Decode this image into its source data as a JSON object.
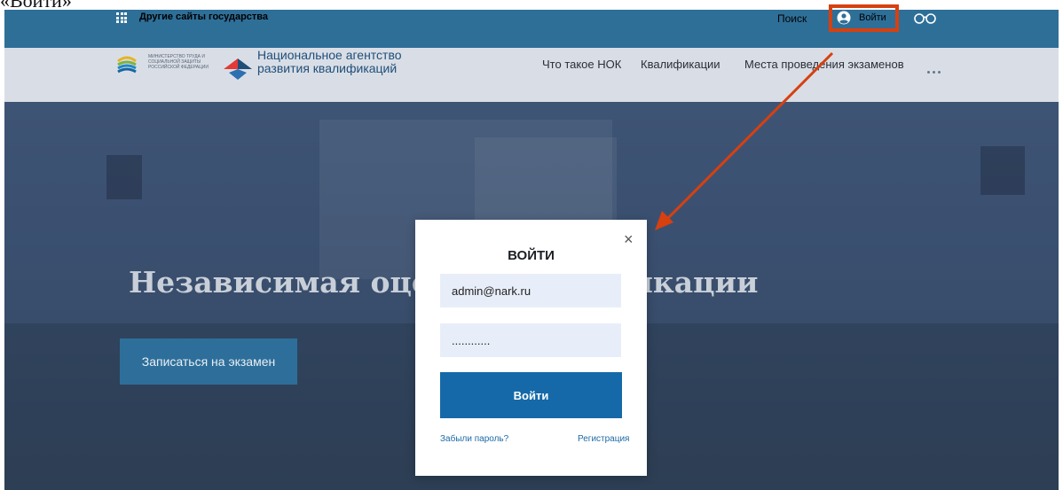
{
  "caption": "«Войти»",
  "topbar": {
    "gov_sites_label": "Другие сайты государства",
    "search_label": "Поиск",
    "login_label": "Войти"
  },
  "navbar": {
    "ministry_logo_text": "министерство труда и социальной защиты российской федерации",
    "agency_name": "Национальное агентство развития квалификаций",
    "items": [
      {
        "label": "Что такое НОК"
      },
      {
        "label": "Квалификации"
      },
      {
        "label": "Места проведения экзаменов"
      }
    ]
  },
  "hero": {
    "title": "Независимая оценка квалификации",
    "cta_label": "Записаться на экзамен"
  },
  "login_modal": {
    "title": "ВОЙТИ",
    "email_value": "admin@nark.ru",
    "password_value": "............",
    "submit_label": "Войти",
    "forgot_label": "Забыли пароль?",
    "register_label": "Регистрация"
  },
  "colors": {
    "topbar": "#2e6f98",
    "highlight": "#d7400f",
    "primary_button": "#1569a8",
    "input_bg": "#e8eef9"
  },
  "icons": [
    "grid-icon",
    "user-icon",
    "glasses-icon",
    "more-icon",
    "close-icon"
  ]
}
